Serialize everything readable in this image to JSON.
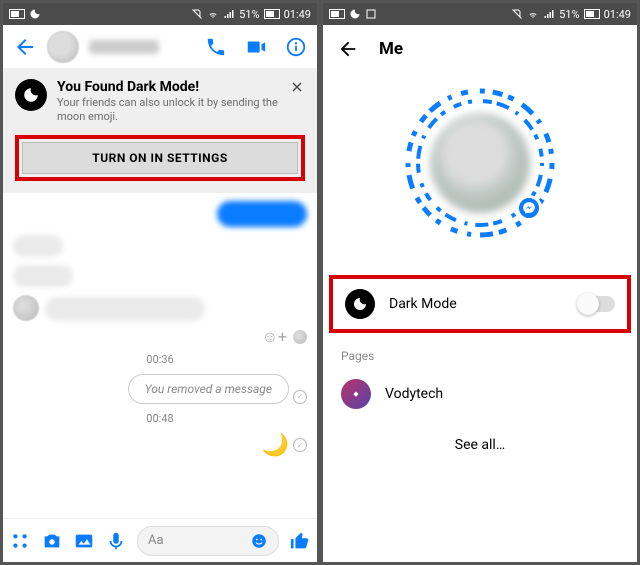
{
  "status": {
    "battery_pct": "51%",
    "time": "01:49"
  },
  "left": {
    "banner": {
      "title": "You Found Dark Mode!",
      "subtitle": "Your friends can also unlock it by sending the moon emoji.",
      "button": "TURN ON IN SETTINGS"
    },
    "timestamps": {
      "t1": "00:36",
      "t2": "00:48"
    },
    "removed_text": "You removed a message",
    "compose_placeholder": "Aa",
    "moon_emoji": "🌙"
  },
  "right": {
    "title": "Me",
    "dark_mode_label": "Dark Mode",
    "pages_label": "Pages",
    "page_name": "Vodytech",
    "see_all": "See all…"
  }
}
